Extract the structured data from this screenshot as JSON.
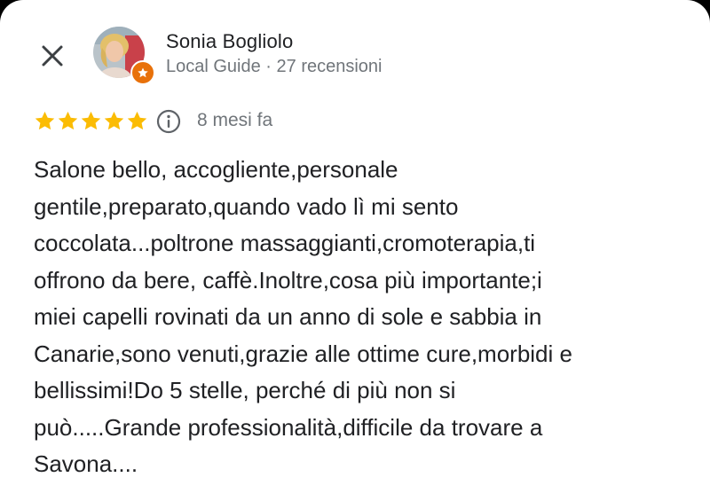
{
  "header": {
    "close_icon": "close-icon",
    "avatar_icon": "user-avatar",
    "badge_icon": "local-guide-star-icon",
    "author_name": "Sonia Bogliolo",
    "author_meta": "Local Guide · 27 recensioni"
  },
  "rating": {
    "stars": 5,
    "max_stars": 5,
    "star_color": "#fbbc04",
    "info_icon": "info-icon",
    "date": "8 mesi fa"
  },
  "review": {
    "lines": [
      "Salone bello, accogliente,personale",
      "gentile,preparato,quando vado lì mi sento",
      "coccolata...poltrone massaggianti,cromoterapia,ti",
      "offrono da bere, caffè.Inoltre,cosa più importante;i",
      "miei capelli rovinati da un anno di sole e sabbia in",
      "Canarie,sono venuti,grazie alle ottime cure,morbidi e",
      "bellissimi!Do 5 stelle, perché di più non si",
      "può.....Grande professionalità,difficile da trovare a",
      "Savona...."
    ]
  },
  "colors": {
    "badge": "#e8710a",
    "primary_text": "#202124",
    "secondary_text": "#70757a"
  }
}
